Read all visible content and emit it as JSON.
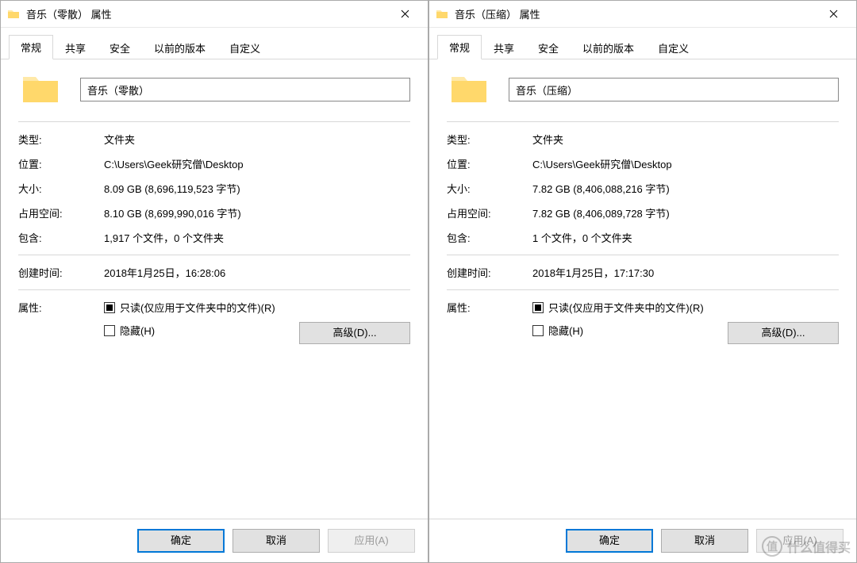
{
  "tabs": [
    "常规",
    "共享",
    "安全",
    "以前的版本",
    "自定义"
  ],
  "labels": {
    "type": "类型:",
    "location": "位置:",
    "size": "大小:",
    "size_on_disk": "占用空间:",
    "contains": "包含:",
    "created": "创建时间:",
    "attributes": "属性:",
    "readonly": "只读(仅应用于文件夹中的文件)(R)",
    "hidden": "隐藏(H)",
    "advanced": "高级(D)..."
  },
  "buttons": {
    "ok": "确定",
    "cancel": "取消",
    "apply": "应用(A)"
  },
  "left": {
    "title": "音乐（零散） 属性",
    "name": "音乐（零散）",
    "type": "文件夹",
    "location": "C:\\Users\\Geek研究僧\\Desktop",
    "size": "8.09 GB (8,696,119,523 字节)",
    "size_on_disk": "8.10 GB (8,699,990,016 字节)",
    "contains": "1,917 个文件，0 个文件夹",
    "created": "2018年1月25日，16:28:06"
  },
  "right": {
    "title": "音乐（压缩） 属性",
    "name": "音乐（压缩）",
    "type": "文件夹",
    "location": "C:\\Users\\Geek研究僧\\Desktop",
    "size": "7.82 GB (8,406,088,216 字节)",
    "size_on_disk": "7.82 GB (8,406,089,728 字节)",
    "contains": "1 个文件，0 个文件夹",
    "created": "2018年1月25日，17:17:30"
  },
  "watermark": {
    "badge": "值",
    "text": "什么值得买"
  }
}
